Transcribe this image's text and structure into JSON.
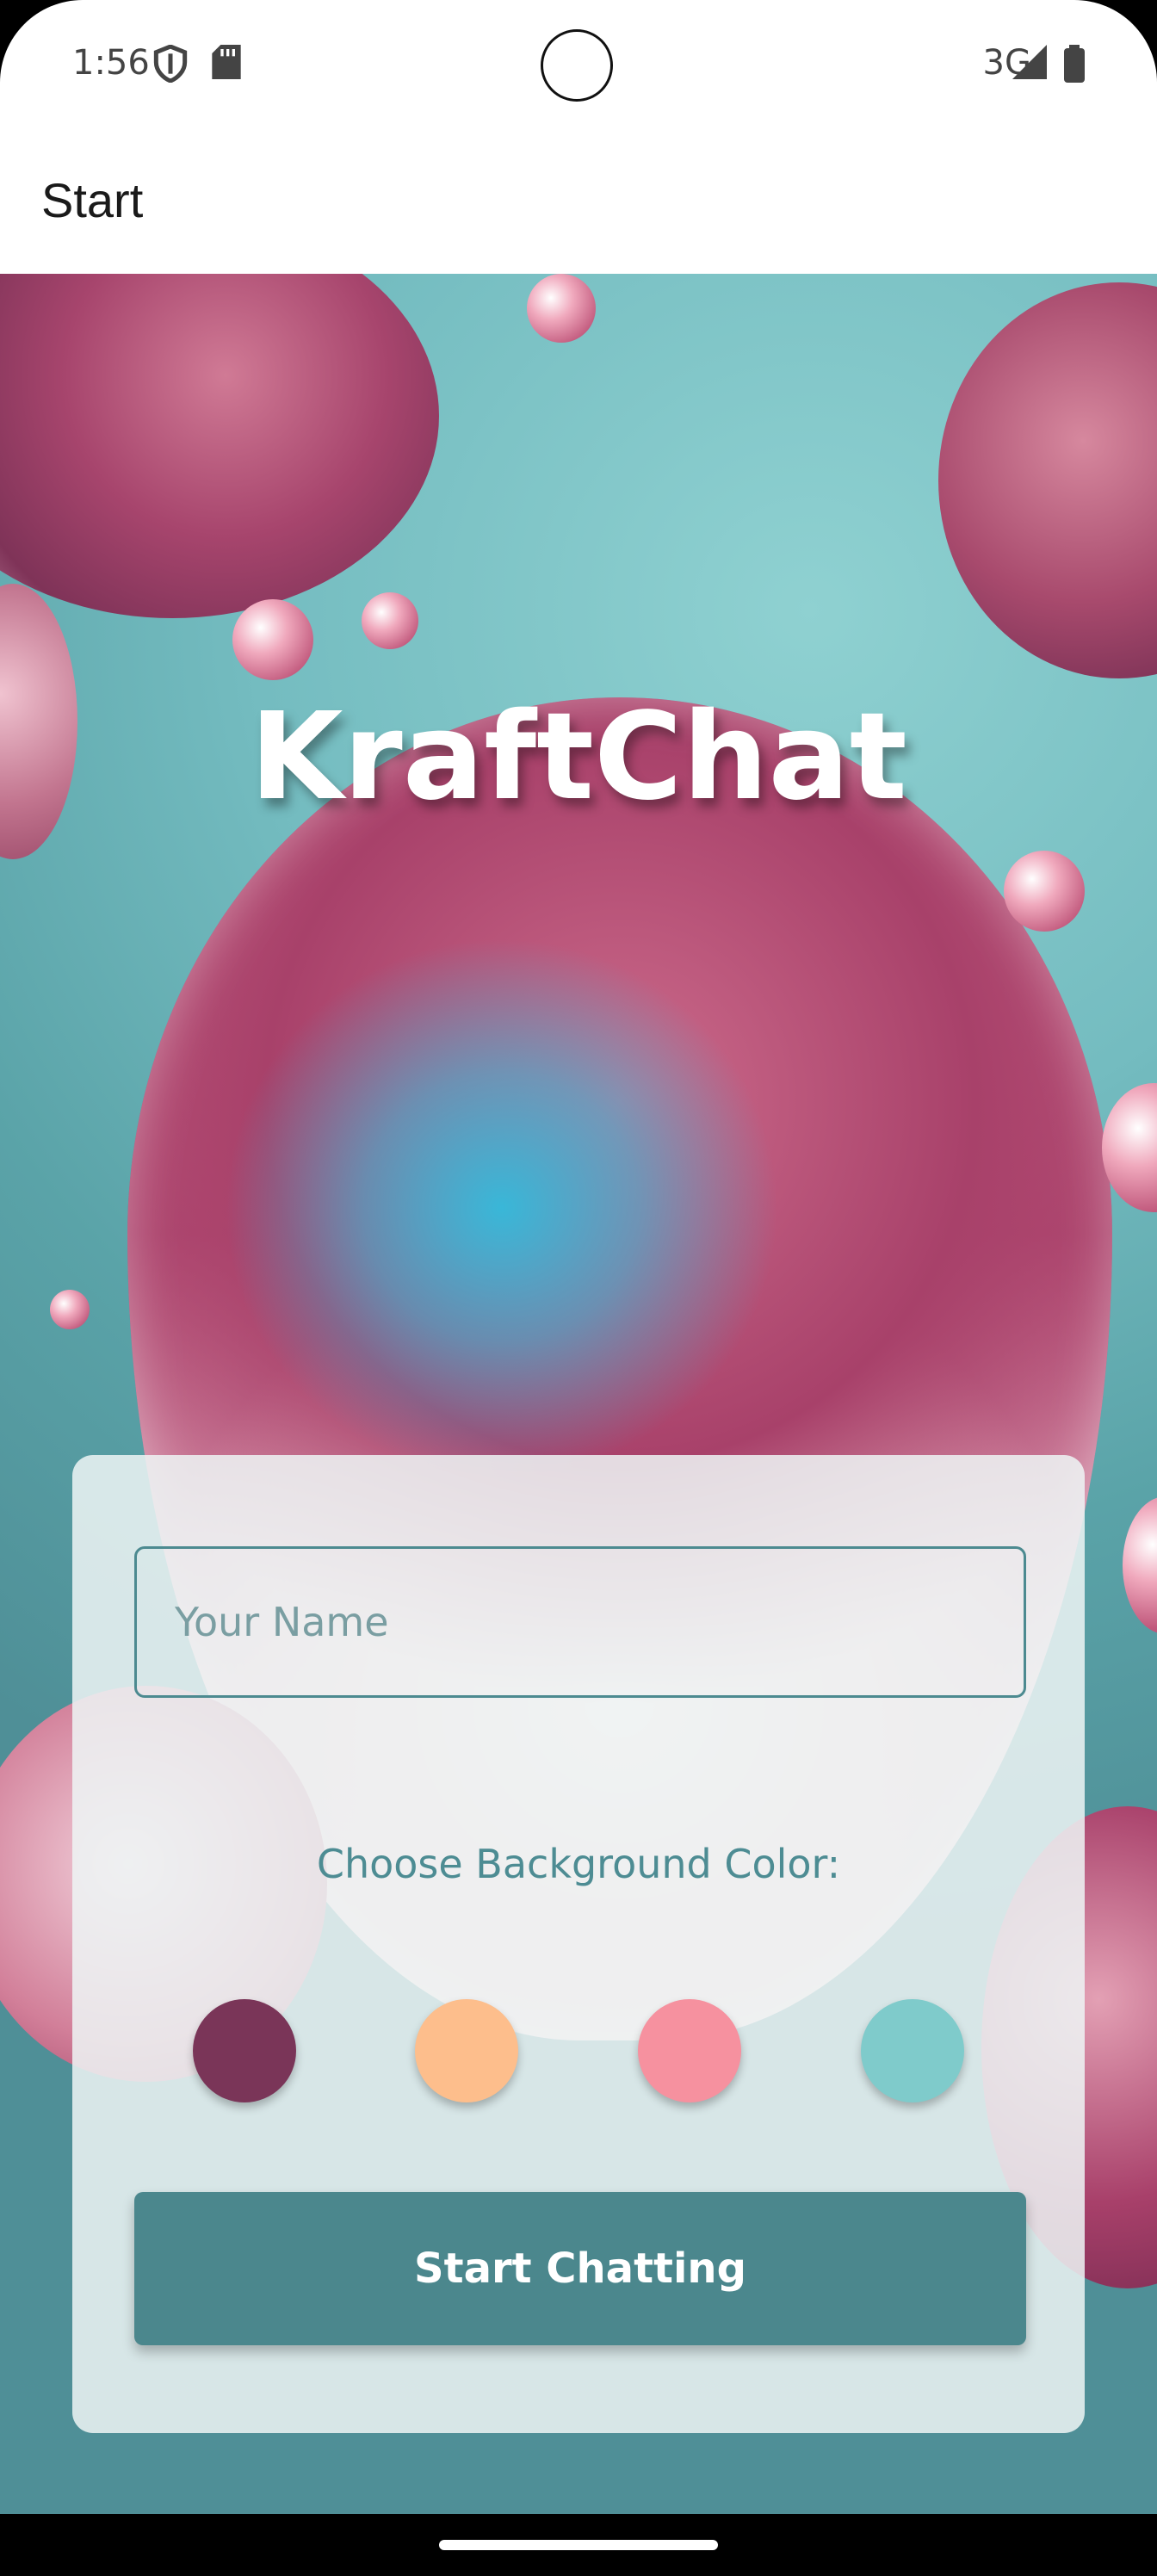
{
  "status_bar": {
    "time": "1:56",
    "network": "3G",
    "icons": [
      "shield-icon",
      "sd-card-icon",
      "signal-icon",
      "battery-icon"
    ]
  },
  "app_bar": {
    "title": "Start"
  },
  "hero": {
    "app_name": "KraftChat"
  },
  "form": {
    "name_placeholder": "Your Name",
    "name_value": "",
    "color_label": "Choose Background Color:",
    "colors": [
      "#7a3558",
      "#fdbe8c",
      "#f6919f",
      "#7fcbcb"
    ],
    "button_label": "Start Chatting"
  }
}
